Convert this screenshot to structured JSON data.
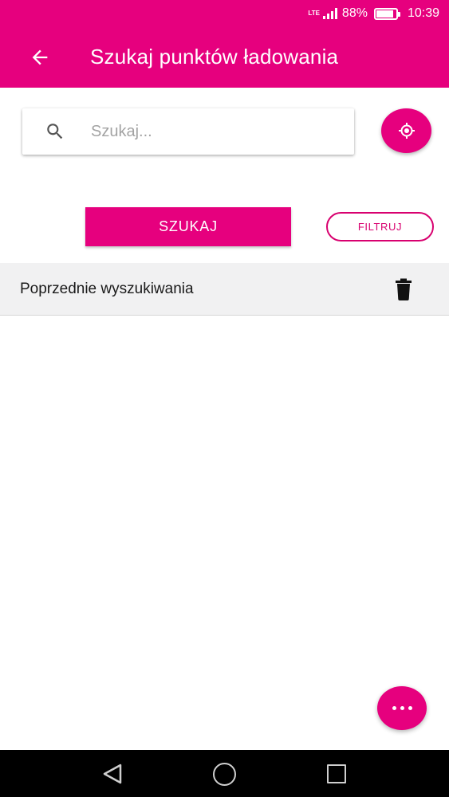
{
  "status_bar": {
    "network": "LTE",
    "battery_percent": "88%",
    "battery_level": 0.88,
    "time": "10:39"
  },
  "app_bar": {
    "title": "Szukaj punktów ładowania"
  },
  "search": {
    "placeholder": "Szukaj...",
    "value": ""
  },
  "actions": {
    "search_label": "SZUKAJ",
    "filter_label": "FILTRUJ"
  },
  "previous_searches": {
    "label": "Poprzednie wyszukiwania",
    "items": []
  },
  "colors": {
    "accent": "#e6007e",
    "header_bg": "#f1f1f2",
    "nav_bg": "#000000"
  },
  "icons": {
    "back": "arrow-left-icon",
    "search": "search-icon",
    "locate": "my-location-icon",
    "delete": "trash-icon",
    "more": "more-horizontal-icon"
  }
}
